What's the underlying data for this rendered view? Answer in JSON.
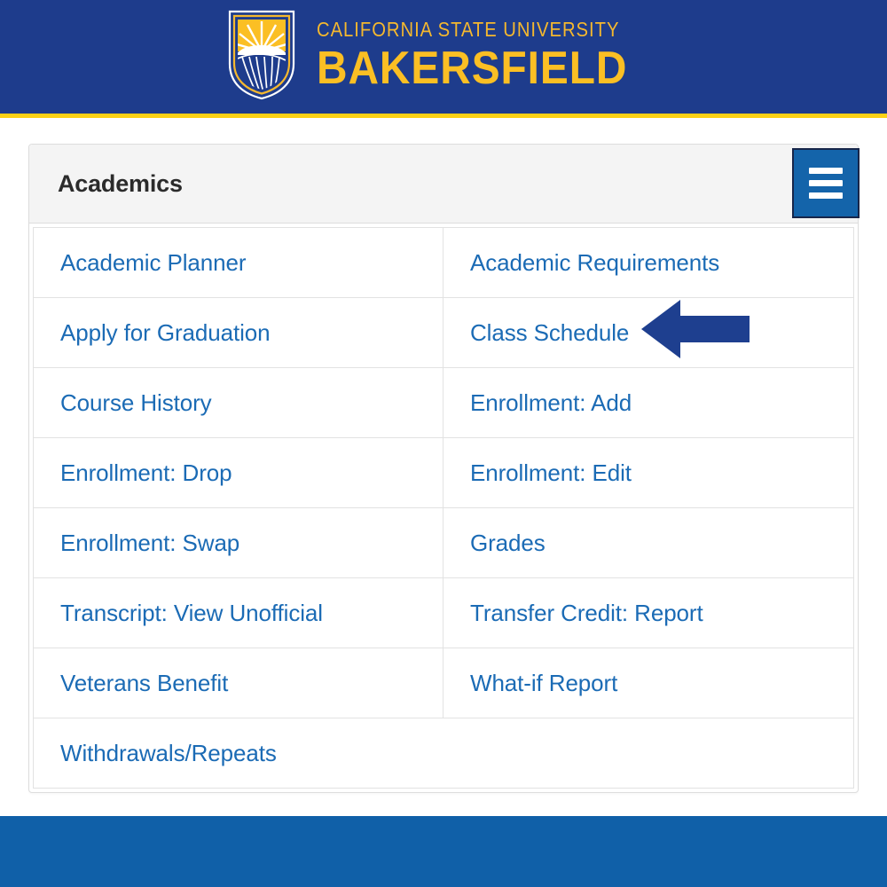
{
  "banner": {
    "logo_icon": "csub-shield-logo",
    "university_line": "CALIFORNIA STATE UNIVERSITY",
    "campus_line": "BAKERSFIELD",
    "background_color": "#1e3c8c",
    "accent_stripe_color": "#fcd116",
    "gold_color": "#f5b82e"
  },
  "card": {
    "title": "Academics",
    "header_background": "#f4f4f4",
    "menu_button": {
      "icon": "hamburger-menu-icon",
      "label": "Menu",
      "background_color": "#1464aa",
      "border_color": "#17264a"
    }
  },
  "menu": {
    "link_color": "#1b6bb5",
    "rows": [
      {
        "left": "Academic Planner",
        "right": "Academic Requirements"
      },
      {
        "left": "Apply for Graduation",
        "right": "Class Schedule"
      },
      {
        "left": "Course History",
        "right": "Enrollment: Add"
      },
      {
        "left": "Enrollment: Drop",
        "right": "Enrollment: Edit"
      },
      {
        "left": "Enrollment: Swap",
        "right": "Grades"
      },
      {
        "left": "Transcript: View Unofficial",
        "right": "Transfer Credit: Report"
      },
      {
        "left": "Veterans Benefit",
        "right": "What-if Report"
      },
      {
        "left": "Withdrawals/Repeats",
        "right": ""
      }
    ]
  },
  "annotation": {
    "icon": "left-arrow-annotation",
    "points_at": "Class Schedule",
    "color": "#1e3f8f"
  },
  "footer": {
    "background_color": "#1060a8"
  }
}
